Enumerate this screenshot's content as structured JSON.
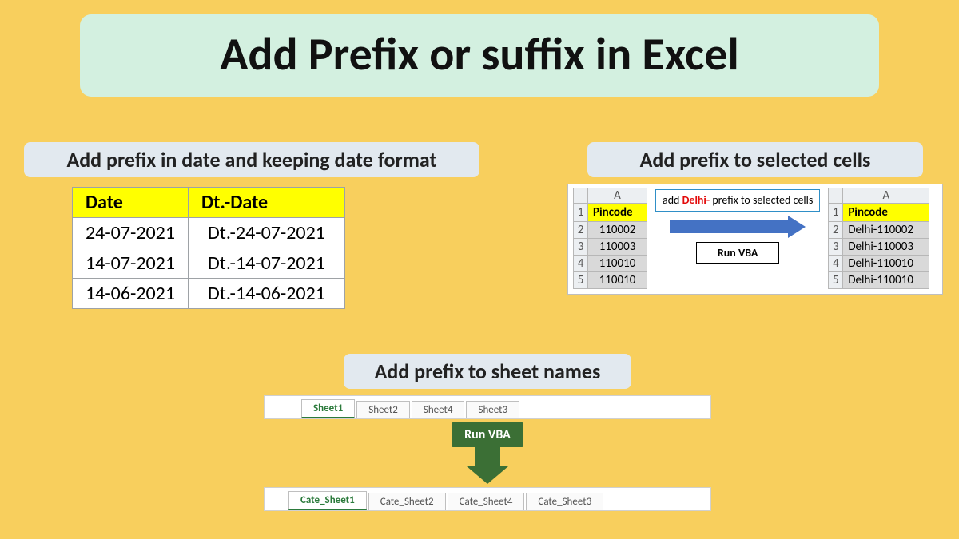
{
  "title": "Add Prefix or suffix in Excel",
  "left": {
    "label": "Add prefix in date and keeping date format",
    "headers": {
      "c1": "Date",
      "c2": "Dt.-Date"
    },
    "rows": [
      {
        "c1": "24-07-2021",
        "c2": "Dt.-24-07-2021"
      },
      {
        "c1": "14-07-2021",
        "c2": "Dt.-14-07-2021"
      },
      {
        "c1": "14-06-2021",
        "c2": "Dt.-14-06-2021"
      }
    ]
  },
  "right": {
    "label": "Add prefix to selected cells",
    "col_header": "A",
    "pin_header": "Pincode",
    "before": [
      "110002",
      "110003",
      "110010",
      "110010"
    ],
    "after": [
      "Delhi-110002",
      "Delhi-110003",
      "Delhi-110010",
      "Delhi-110010"
    ],
    "note_prefix": "add ",
    "note_red": "Delhi-",
    "note_suffix": " prefix to selected cells",
    "run_vba": "Run VBA"
  },
  "bottom": {
    "label": "Add prefix to sheet names",
    "before_tabs": [
      "Sheet1",
      "Sheet2",
      "Sheet4",
      "Sheet3"
    ],
    "after_tabs": [
      "Cate_Sheet1",
      "Cate_Sheet2",
      "Cate_Sheet4",
      "Cate_Sheet3"
    ],
    "run_vba": "Run VBA"
  }
}
